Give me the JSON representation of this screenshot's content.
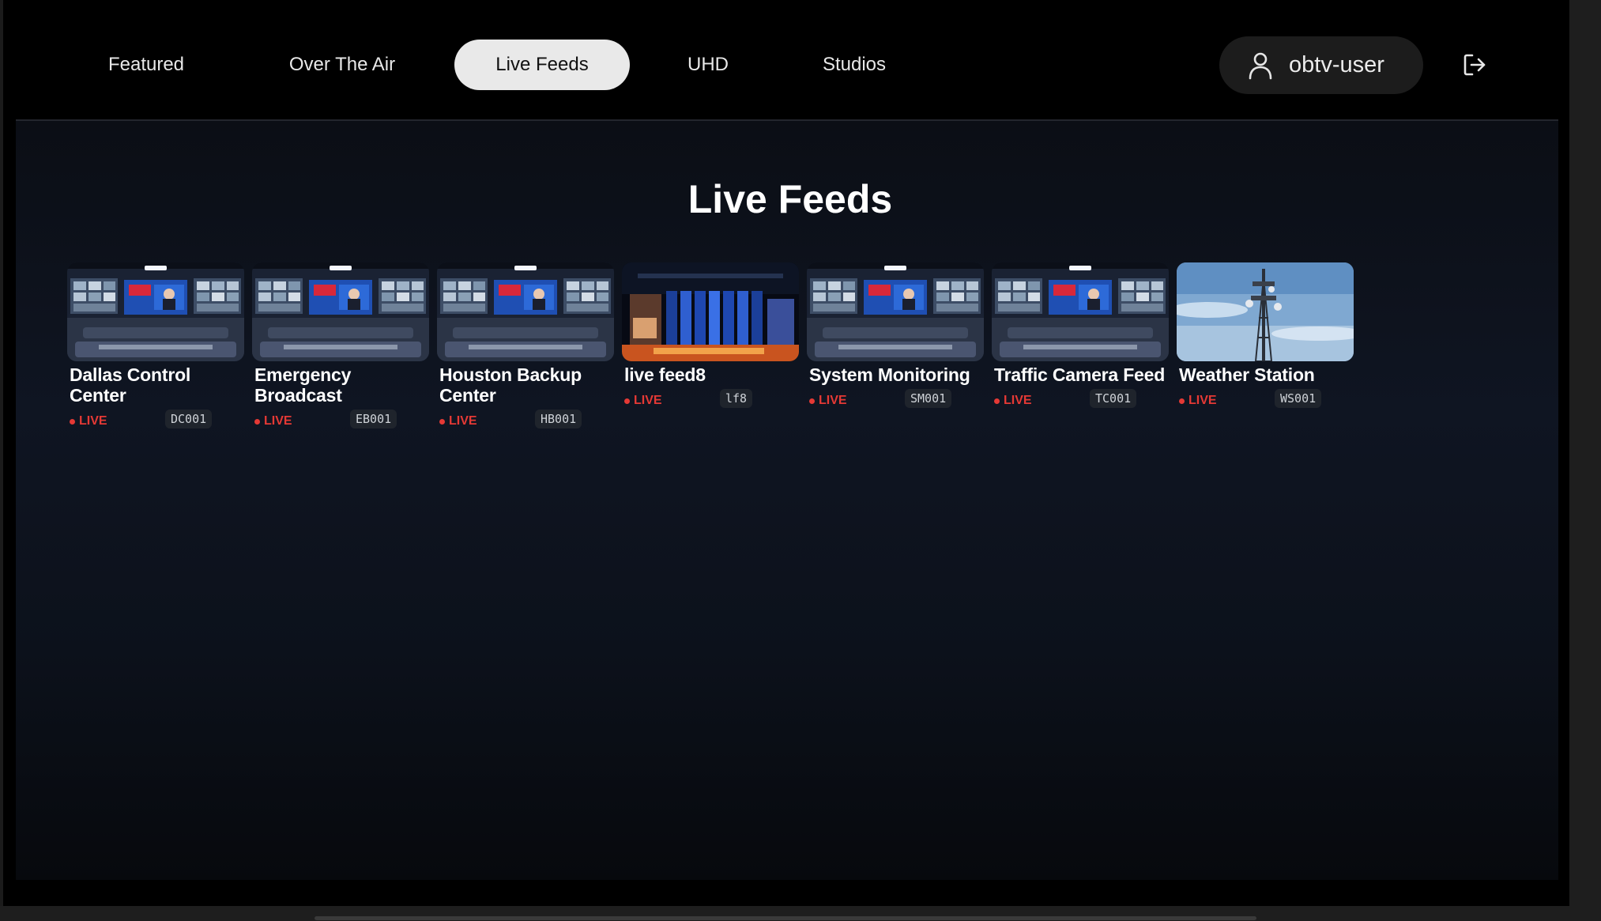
{
  "nav": {
    "tabs": [
      {
        "label": "Featured",
        "active": false
      },
      {
        "label": "Over The Air",
        "active": false
      },
      {
        "label": "Live Feeds",
        "active": true
      },
      {
        "label": "UHD",
        "active": false
      },
      {
        "label": "Studios",
        "active": false
      }
    ],
    "user": {
      "name": "obtv-user",
      "icon": "user-icon"
    },
    "logout_icon": "logout-icon"
  },
  "page": {
    "title": "Live Feeds"
  },
  "feeds": [
    {
      "title": "Dallas Control Center",
      "status": "LIVE",
      "code": "DC001",
      "thumbnail": "control-room"
    },
    {
      "title": "Emergency Broadcast",
      "status": "LIVE",
      "code": "EB001",
      "thumbnail": "control-room"
    },
    {
      "title": "Houston Backup Center",
      "status": "LIVE",
      "code": "HB001",
      "thumbnail": "control-room"
    },
    {
      "title": "live feed8",
      "status": "LIVE",
      "code": "lf8",
      "thumbnail": "studio-stage"
    },
    {
      "title": "System Monitoring",
      "status": "LIVE",
      "code": "SM001",
      "thumbnail": "control-room"
    },
    {
      "title": "Traffic Camera Feed",
      "status": "LIVE",
      "code": "TC001",
      "thumbnail": "control-room"
    },
    {
      "title": "Weather Station",
      "status": "LIVE",
      "code": "WS001",
      "thumbnail": "cell-tower"
    }
  ],
  "colors": {
    "live": "#e53935",
    "active_tab": "#e9e9e9",
    "background": "#000000"
  }
}
